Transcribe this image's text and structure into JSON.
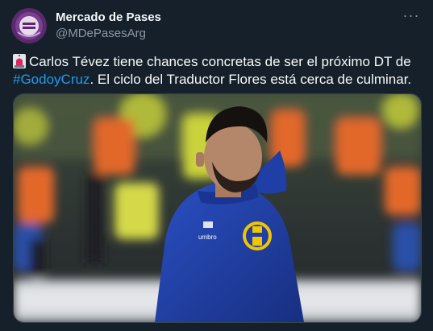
{
  "tweet": {
    "author": {
      "display_name": "Mercado de Pases",
      "handle": "@MDePasesArg",
      "avatar_icon": "mercado-de-pases-logo"
    },
    "more_icon": "more-options-icon",
    "text": {
      "emoji": "siren-emoji",
      "part1": "Carlos Tévez tiene chances concretas de ser el próximo DT de ",
      "hashtag": "#GodoyCruz",
      "part2": ". El ciclo del Traductor Flores está cerca de culminar."
    },
    "media": {
      "description_icon": "photo",
      "jacket_logo_text": "umbro",
      "colors": {
        "jacket": "#1f3fa6",
        "crest": "#f2c500",
        "background_orange": "#e2672a",
        "background_yellow": "#c9d23a"
      }
    }
  },
  "colors": {
    "background": "#15202b",
    "text": "#f7f9f9",
    "secondary_text": "#8b98a5",
    "link": "#1d9bf0"
  }
}
